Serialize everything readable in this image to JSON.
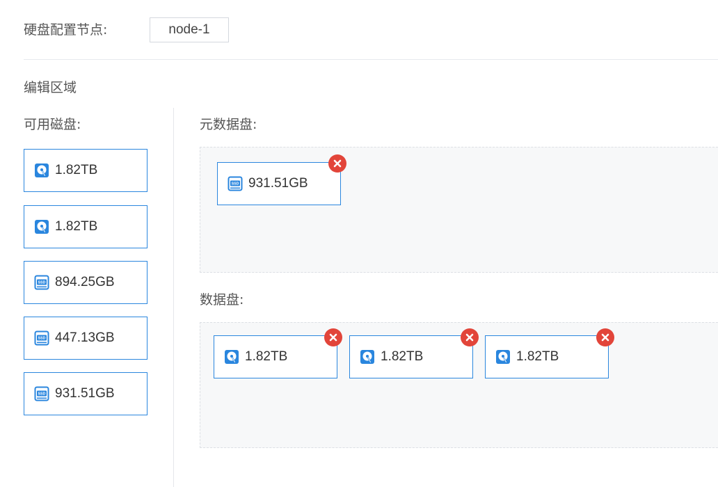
{
  "header": {
    "node_label": "硬盘配置节点:",
    "node_value": "node-1"
  },
  "editor": {
    "title": "编辑区域",
    "available_label": "可用磁盘:",
    "metadata_label": "元数据盘:",
    "data_label": "数据盘:"
  },
  "available_disks": [
    {
      "type": "hdd",
      "size": "1.82TB"
    },
    {
      "type": "hdd",
      "size": "1.82TB"
    },
    {
      "type": "ssd",
      "size": "894.25GB"
    },
    {
      "type": "ssd",
      "size": "447.13GB"
    },
    {
      "type": "ssd",
      "size": "931.51GB"
    }
  ],
  "metadata_disks": [
    {
      "type": "ssd",
      "size": "931.51GB"
    }
  ],
  "data_disks": [
    {
      "type": "hdd",
      "size": "1.82TB"
    },
    {
      "type": "hdd",
      "size": "1.82TB"
    },
    {
      "type": "hdd",
      "size": "1.82TB"
    }
  ],
  "colors": {
    "accent": "#2a86de",
    "remove": "#e2453a",
    "zone_bg": "#f7f8f9"
  }
}
